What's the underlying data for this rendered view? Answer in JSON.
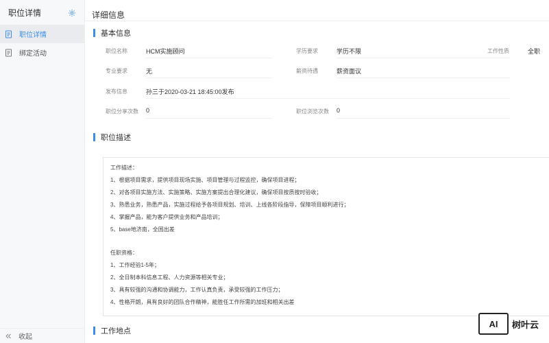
{
  "sidebar": {
    "title": "职位详情",
    "items": [
      {
        "label": "职位详情",
        "active": true
      },
      {
        "label": "绑定活动",
        "active": false
      }
    ],
    "footer": "收起"
  },
  "main": {
    "title": "详细信息",
    "basic": {
      "heading": "基本信息",
      "name_label": "职位名称",
      "name_value": "HCM实施顾问",
      "edu_label": "学历要求",
      "edu_value": "学历不限",
      "type_label": "工作性质",
      "type_value": "全职",
      "major_label": "专业要求",
      "major_value": "无",
      "salary_label": "薪资待遇",
      "salary_value": "薪资面议",
      "publish_label": "发布信息",
      "publish_value": "孙三于2020-03-21 18:45:00发布",
      "share_label": "职位分享次数",
      "share_value": "0",
      "views_label": "职位浏览次数",
      "views_value": "0"
    },
    "desc": {
      "heading": "职位描述",
      "lines_a": [
        "工作描述：",
        "1、根据项目需求，提供项目现场实施、项目管理与过程监控，确保项目进程；",
        "2、对各项目实施方法、实施策略、实施方案提出合理化建议，确保项目按质按时验收；",
        "3、熟悉业务，熟悉产品，实施过程给予各项目规划、培训、上线各阶段指导，保障项目顺利进行；",
        "4、掌握产品，能为客户提供业务和产品培训；",
        "5、base地济南，全国出差"
      ],
      "lines_b": [
        "任职资格：",
        "1、工作经验1-5年；",
        "2、全日制本科信息工程、人力资源等相关专业；",
        "3、具有较强的沟通和协调能力，工作认真负责，承受较强的工作压力；",
        "4、性格开朗，具有良好的团队合作精神，能胜任工作所需的加班和相关出差"
      ]
    },
    "location": {
      "heading": "工作地点"
    }
  },
  "watermark": {
    "badge": "AI",
    "text": "树叶云"
  },
  "colors": {
    "accent": "#3a8ee6"
  }
}
